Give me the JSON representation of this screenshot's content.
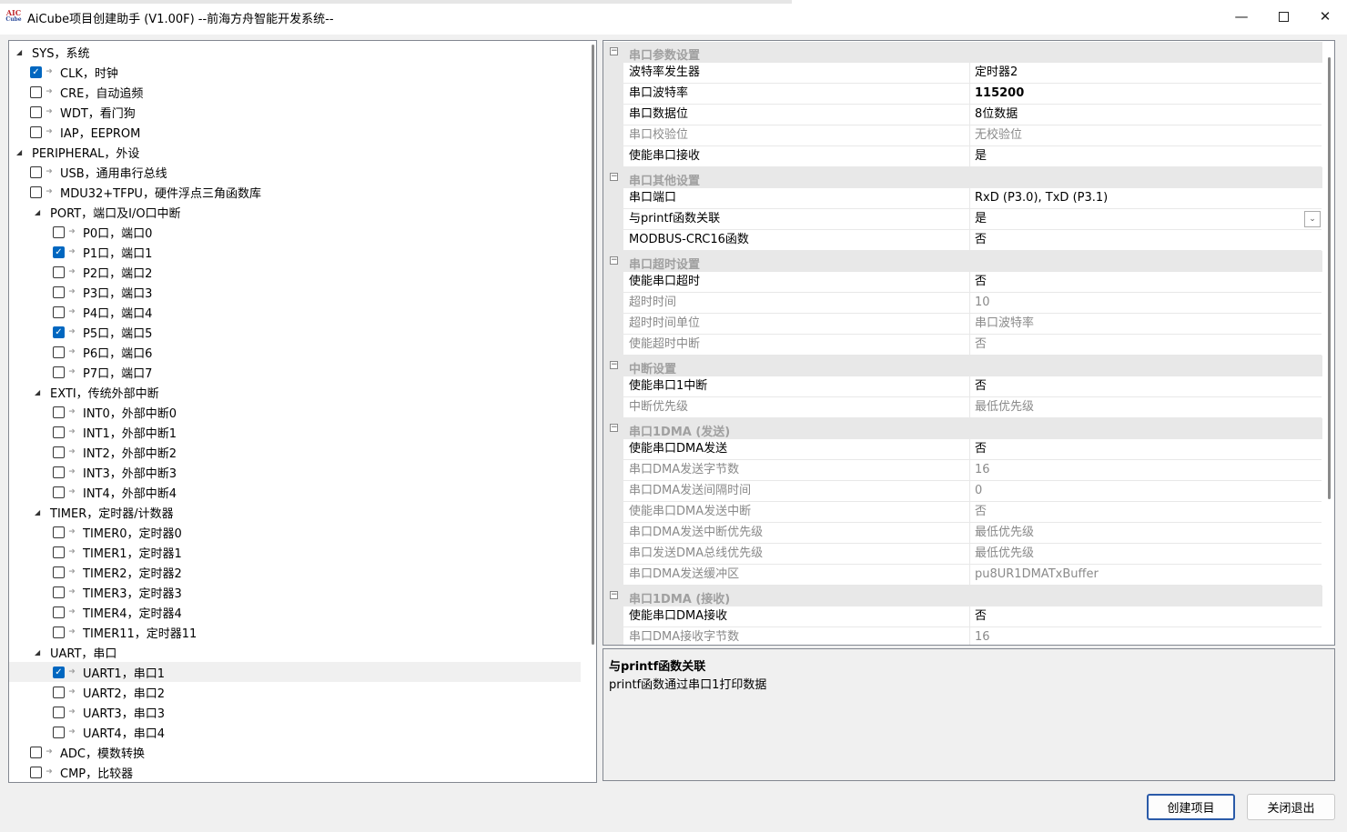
{
  "window": {
    "title": "AiCube项目创建助手 (V1.00F) --前海方舟智能开发系统--",
    "icon_text_top": "AIC",
    "icon_text_bottom": "Cube"
  },
  "tree": [
    {
      "label": "SYS，系统",
      "level": 0,
      "type": "group",
      "expanded": true
    },
    {
      "label": "CLK，时钟",
      "level": 1,
      "type": "item",
      "checked": true
    },
    {
      "label": "CRE，自动追频",
      "level": 1,
      "type": "item",
      "checked": false
    },
    {
      "label": "WDT，看门狗",
      "level": 1,
      "type": "item",
      "checked": false
    },
    {
      "label": "IAP，EEPROM",
      "level": 1,
      "type": "item",
      "checked": false
    },
    {
      "label": "PERIPHERAL，外设",
      "level": 0,
      "type": "group",
      "expanded": true
    },
    {
      "label": "USB，通用串行总线",
      "level": 1,
      "type": "item",
      "checked": false
    },
    {
      "label": "MDU32+TFPU，硬件浮点三角函数库",
      "level": 1,
      "type": "item",
      "checked": false
    },
    {
      "label": "PORT，端口及I/O口中断",
      "level": 1,
      "type": "group",
      "expanded": true
    },
    {
      "label": "P0口，端口0",
      "level": 2,
      "type": "item",
      "checked": false
    },
    {
      "label": "P1口，端口1",
      "level": 2,
      "type": "item",
      "checked": true
    },
    {
      "label": "P2口，端口2",
      "level": 2,
      "type": "item",
      "checked": false
    },
    {
      "label": "P3口，端口3",
      "level": 2,
      "type": "item",
      "checked": false
    },
    {
      "label": "P4口，端口4",
      "level": 2,
      "type": "item",
      "checked": false
    },
    {
      "label": "P5口，端口5",
      "level": 2,
      "type": "item",
      "checked": true
    },
    {
      "label": "P6口，端口6",
      "level": 2,
      "type": "item",
      "checked": false
    },
    {
      "label": "P7口，端口7",
      "level": 2,
      "type": "item",
      "checked": false
    },
    {
      "label": "EXTI，传统外部中断",
      "level": 1,
      "type": "group",
      "expanded": true
    },
    {
      "label": "INT0，外部中断0",
      "level": 2,
      "type": "item",
      "checked": false
    },
    {
      "label": "INT1，外部中断1",
      "level": 2,
      "type": "item",
      "checked": false
    },
    {
      "label": "INT2，外部中断2",
      "level": 2,
      "type": "item",
      "checked": false
    },
    {
      "label": "INT3，外部中断3",
      "level": 2,
      "type": "item",
      "checked": false
    },
    {
      "label": "INT4，外部中断4",
      "level": 2,
      "type": "item",
      "checked": false
    },
    {
      "label": "TIMER，定时器/计数器",
      "level": 1,
      "type": "group",
      "expanded": true
    },
    {
      "label": "TIMER0，定时器0",
      "level": 2,
      "type": "item",
      "checked": false
    },
    {
      "label": "TIMER1，定时器1",
      "level": 2,
      "type": "item",
      "checked": false
    },
    {
      "label": "TIMER2，定时器2",
      "level": 2,
      "type": "item",
      "checked": false
    },
    {
      "label": "TIMER3，定时器3",
      "level": 2,
      "type": "item",
      "checked": false
    },
    {
      "label": "TIMER4，定时器4",
      "level": 2,
      "type": "item",
      "checked": false
    },
    {
      "label": "TIMER11，定时器11",
      "level": 2,
      "type": "item",
      "checked": false
    },
    {
      "label": "UART，串口",
      "level": 1,
      "type": "group",
      "expanded": true
    },
    {
      "label": "UART1，串口1",
      "level": 2,
      "type": "item",
      "checked": true,
      "selected": true
    },
    {
      "label": "UART2，串口2",
      "level": 2,
      "type": "item",
      "checked": false
    },
    {
      "label": "UART3，串口3",
      "level": 2,
      "type": "item",
      "checked": false
    },
    {
      "label": "UART4，串口4",
      "level": 2,
      "type": "item",
      "checked": false
    },
    {
      "label": "ADC，模数转换",
      "level": 1,
      "type": "item",
      "checked": false
    },
    {
      "label": "CMP，比较器",
      "level": 1,
      "type": "item",
      "checked": false
    }
  ],
  "properties": [
    {
      "kind": "category",
      "name": "串口参数设置"
    },
    {
      "kind": "prop",
      "name": "波特率发生器",
      "value": "定时器2",
      "readonly": false
    },
    {
      "kind": "prop",
      "name": "串口波特率",
      "value": "115200",
      "readonly": false,
      "bold": true
    },
    {
      "kind": "prop",
      "name": "串口数据位",
      "value": "8位数据",
      "readonly": false
    },
    {
      "kind": "prop",
      "name": "串口校验位",
      "value": "无校验位",
      "readonly": true
    },
    {
      "kind": "prop",
      "name": "使能串口接收",
      "value": "是",
      "readonly": false
    },
    {
      "kind": "category",
      "name": "串口其他设置"
    },
    {
      "kind": "prop",
      "name": "串口端口",
      "value": "RxD (P3.0), TxD (P3.1)",
      "readonly": false
    },
    {
      "kind": "prop",
      "name": "与printf函数关联",
      "value": "是",
      "readonly": false,
      "dropdown": true
    },
    {
      "kind": "prop",
      "name": "MODBUS-CRC16函数",
      "value": "否",
      "readonly": false
    },
    {
      "kind": "category",
      "name": "串口超时设置"
    },
    {
      "kind": "prop",
      "name": "使能串口超时",
      "value": "否",
      "readonly": false
    },
    {
      "kind": "prop",
      "name": "超时时间",
      "value": "10",
      "readonly": true
    },
    {
      "kind": "prop",
      "name": "超时时间单位",
      "value": "串口波特率",
      "readonly": true
    },
    {
      "kind": "prop",
      "name": "使能超时中断",
      "value": "否",
      "readonly": true
    },
    {
      "kind": "category",
      "name": "中断设置"
    },
    {
      "kind": "prop",
      "name": "使能串口1中断",
      "value": "否",
      "readonly": false
    },
    {
      "kind": "prop",
      "name": "中断优先级",
      "value": "最低优先级",
      "readonly": true
    },
    {
      "kind": "category",
      "name": "串口1DMA (发送)"
    },
    {
      "kind": "prop",
      "name": "使能串口DMA发送",
      "value": "否",
      "readonly": false
    },
    {
      "kind": "prop",
      "name": "串口DMA发送字节数",
      "value": "16",
      "readonly": true
    },
    {
      "kind": "prop",
      "name": "串口DMA发送间隔时间",
      "value": "0",
      "readonly": true
    },
    {
      "kind": "prop",
      "name": "使能串口DMA发送中断",
      "value": "否",
      "readonly": true
    },
    {
      "kind": "prop",
      "name": "串口DMA发送中断优先级",
      "value": "最低优先级",
      "readonly": true
    },
    {
      "kind": "prop",
      "name": "串口发送DMA总线优先级",
      "value": "最低优先级",
      "readonly": true
    },
    {
      "kind": "prop",
      "name": "串口DMA发送缓冲区",
      "value": "pu8UR1DMATxBuffer",
      "readonly": true
    },
    {
      "kind": "category",
      "name": "串口1DMA (接收)"
    },
    {
      "kind": "prop",
      "name": "使能串口DMA接收",
      "value": "否",
      "readonly": false
    },
    {
      "kind": "prop",
      "name": "串口DMA接收字节数",
      "value": "16",
      "readonly": true
    }
  ],
  "description": {
    "title": "与printf函数关联",
    "text": "printf函数通过串口1打印数据"
  },
  "buttons": {
    "create": "创建项目",
    "close": "关闭退出"
  }
}
